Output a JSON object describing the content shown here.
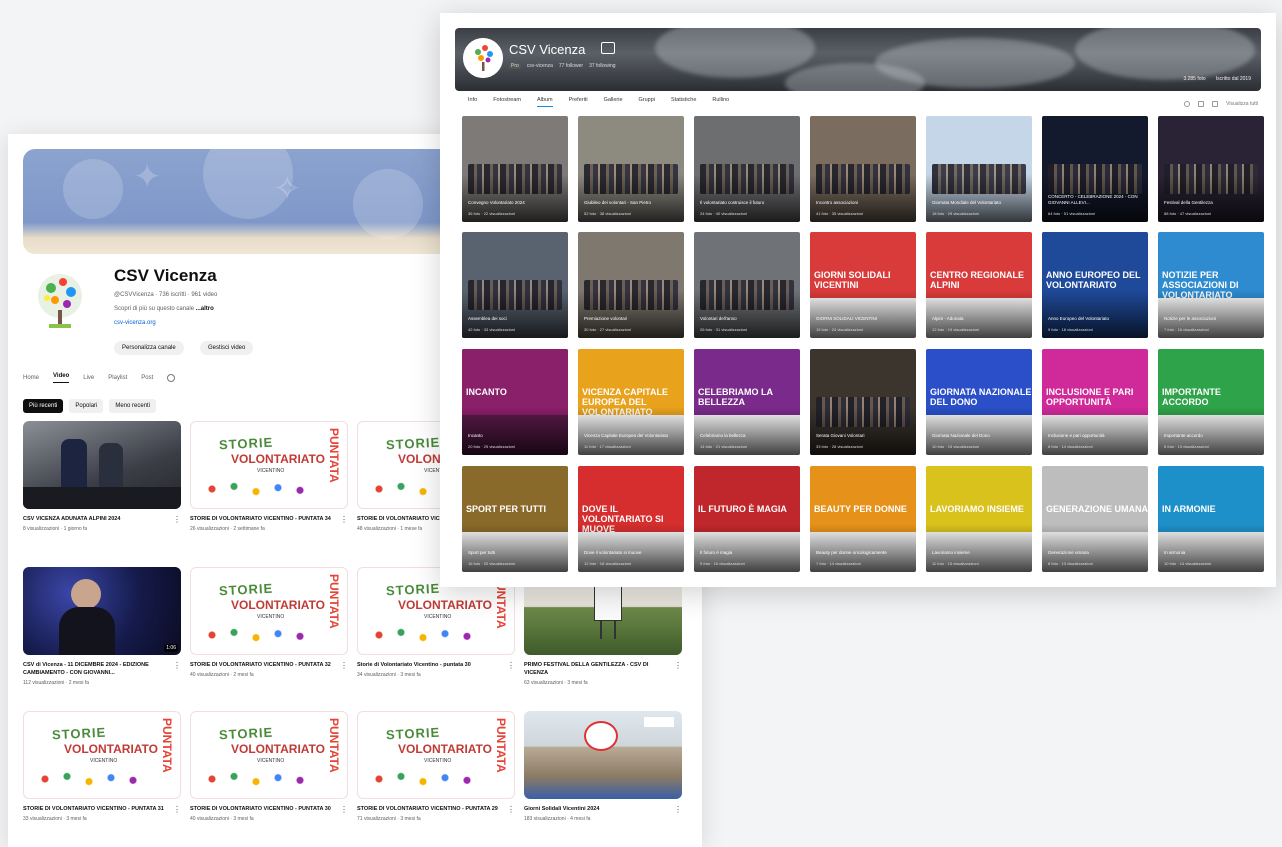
{
  "youtube": {
    "channel_name": "CSV Vicenza",
    "channel_meta": "@CSVVicenza · 736 iscritti · 961 video",
    "description": "Scopri di più su questo canale",
    "description_more": "...altro",
    "link": "csv-vicenza.org",
    "customize_label": "Personalizza canale",
    "manage_label": "Gestisci video",
    "tabs": [
      "Home",
      "Video",
      "Live",
      "Playlist",
      "Post"
    ],
    "active_tab": "Video",
    "filters": [
      "Più recenti",
      "Popolari",
      "Meno recenti"
    ],
    "videos": [
      {
        "title": "CSV VICENZA ADUNATA ALPINI 2024",
        "meta": "8 visualizzazioni · 1 giorno fa"
      },
      {
        "title": "STORIE DI VOLONTARIATO VICENTINO - PUNTATA 34",
        "meta": "26 visualizzazioni · 2 settimane fa"
      },
      {
        "title": "STORIE DI VOLONTARIATO VICENTINO - PUNTATA 33",
        "meta": "48 visualizzazioni · 1 mese fa"
      },
      {
        "title": "CSV di Vicenza - 11 DICEMBRE 2024 - EDIZIONE CAMBIAMENTO - CON GIOVANNI...",
        "meta": "112 visualizzazioni · 2 mesi fa",
        "duration": "1:06"
      },
      {
        "title": "STORIE DI VOLONTARIATO VICENTINO - PUNTATA 32",
        "meta": "40 visualizzazioni · 2 mesi fa"
      },
      {
        "title": "Storie di Volontariato Vicentino - puntata 30",
        "meta": "34 visualizzazioni · 3 mesi fa"
      },
      {
        "title": "PRIMO FESTIVAL DELLA GENTILEZZA - CSV DI VICENZA",
        "meta": "63 visualizzazioni · 3 mesi fa"
      },
      {
        "title": "STORIE DI VOLONTARIATO VICENTINO - PUNTATA 31",
        "meta": "33 visualizzazioni · 3 mesi fa"
      },
      {
        "title": "STORIE DI VOLONTARIATO VICENTINO - PUNTATA 30",
        "meta": "40 visualizzazioni · 3 mesi fa"
      },
      {
        "title": "STORIE DI VOLONTARIATO VICENTINO - PUNTATA 29",
        "meta": "71 visualizzazioni · 3 mesi fa"
      },
      {
        "title": "Giorni Solidali Vicentini 2024",
        "meta": "183 visualizzazioni · 4 mesi fa"
      }
    ],
    "storie_word1": "STORIE",
    "storie_word2": "VOLONTARIATO",
    "storie_word3": "VICENTINO",
    "puntata_label": "PUNTATA"
  },
  "flickr": {
    "name": "CSV Vicenza",
    "sub": [
      "Pro",
      "csv-vicenza",
      "77 follower",
      "37 following"
    ],
    "stats": [
      "3.285 foto",
      "Iscritto dal 2019"
    ],
    "tabs": [
      "Info",
      "Fotostream",
      "Album",
      "Preferiti",
      "Gallerie",
      "Gruppi",
      "Statistiche",
      "Rullino"
    ],
    "active_tab": "Album",
    "share_label": "Visualizza tutti",
    "albums": [
      {
        "title": "Convegno Volontariato 2024",
        "meta": "36 foto · 22 visualizzazioni",
        "bg": "#7e7a78"
      },
      {
        "title": "Giubileo dei volontari - San Pietro",
        "meta": "52 foto · 38 visualizzazioni",
        "bg": "#8d8a80"
      },
      {
        "title": "Il volontariato costruisce il futuro",
        "meta": "24 foto · 40 visualizzazioni",
        "bg": "#6d6e70"
      },
      {
        "title": "Incontro associazioni",
        "meta": "41 foto · 35 visualizzazioni",
        "bg": "#7a6c5e"
      },
      {
        "title": "Giornata Mondiale del Volontariato",
        "meta": "18 foto · 29 visualizzazioni",
        "bg": "#c5d6e8"
      },
      {
        "title": "CONCERTO - CELEBRAZIONE 2024 - CON GIOVANNI ALLEVI...",
        "meta": "64 foto · 51 visualizzazioni",
        "bg": "#141a2e"
      },
      {
        "title": "Festival della Gentilezza",
        "meta": "88 foto · 47 visualizzazioni",
        "bg": "#2a2335"
      },
      {
        "title": "Assemblea dei soci",
        "meta": "42 foto · 33 visualizzazioni",
        "bg": "#596370"
      },
      {
        "title": "Premiazione volontari",
        "meta": "30 foto · 27 visualizzazioni",
        "bg": "#7f786e"
      },
      {
        "title": "Volontari dell'anno",
        "meta": "26 foto · 31 visualizzazioni",
        "bg": "#6f7377"
      },
      {
        "title": "GIORNI SOLIDALI VICENTINI",
        "meta": "15 foto · 24 visualizzazioni",
        "bg": "#ffffff",
        "banner": "#d93b3b",
        "text": "GIORNI SOLIDALI VICENTINI"
      },
      {
        "title": "Alpini - Adunata",
        "meta": "12 foto · 19 visualizzazioni",
        "bg": "#ffffff",
        "banner": "#d93b3b",
        "text": "CENTRO REGIONALE ALPINI"
      },
      {
        "title": "Anno Europeo del Volontariato",
        "meta": "9 foto · 18 visualizzazioni",
        "bg": "#1f4a9a",
        "banner": "#1f4a9a",
        "text": "ANNO EUROPEO DEL VOLONTARIATO"
      },
      {
        "title": "Notizie per le associazioni",
        "meta": "7 foto · 16 visualizzazioni",
        "bg": "#ffffff",
        "banner": "#2e8bd0",
        "text": "NOTIZIE PER ASSOCIAZIONI DI VOLONTARIATO"
      },
      {
        "title": "Incanto",
        "meta": "20 foto · 25 visualizzazioni",
        "bg": "#5a1a4a",
        "banner": "#8a1f6a",
        "text": "INCANTO"
      },
      {
        "title": "Vicenza Capitale Europea del Volontariato",
        "meta": "11 foto · 17 visualizzazioni",
        "bg": "#ffffff",
        "banner": "#e8a21c",
        "text": "VICENZA CAPITALE EUROPEA DEL VOLONTARIATO"
      },
      {
        "title": "Celebriamo la bellezza",
        "meta": "14 foto · 21 visualizzazioni",
        "bg": "#ffffff",
        "banner": "#7a2a8a",
        "text": "CELEBRIAMO LA BELLEZZA"
      },
      {
        "title": "Serata Giovani Volontari",
        "meta": "33 foto · 28 visualizzazioni",
        "bg": "#3c352e"
      },
      {
        "title": "Giornata Nazionale del Dono",
        "meta": "10 foto · 15 visualizzazioni",
        "bg": "#ffffff",
        "banner": "#2a4fc8",
        "text": "GIORNATA NAZIONALE DEL DONO"
      },
      {
        "title": "Inclusione e pari opportunità",
        "meta": "8 foto · 14 visualizzazioni",
        "bg": "#ffffff",
        "banner": "#d0299a",
        "text": "INCLUSIONE E PARI OPPORTUNITÀ"
      },
      {
        "title": "Importante accordo",
        "meta": "6 foto · 13 visualizzazioni",
        "bg": "#ffffff",
        "banner": "#2ea34a",
        "text": "IMPORTANTE ACCORDO"
      },
      {
        "title": "Sport per tutti",
        "meta": "16 foto · 20 visualizzazioni",
        "bg": "#ffffff",
        "banner": "#8a6a2a",
        "text": "SPORT PER TUTTI"
      },
      {
        "title": "Dove il volontariato si muove",
        "meta": "12 foto · 18 visualizzazioni",
        "bg": "#ffffff",
        "banner": "#d62e2e",
        "text": "DOVE IL VOLONTARIATO SI MUOVE"
      },
      {
        "title": "Il futuro è magia",
        "meta": "9 foto · 16 visualizzazioni",
        "bg": "#ffffff",
        "banner": "#c0272d",
        "text": "IL FUTURO È MAGIA"
      },
      {
        "title": "Beauty per donne oncologicamente",
        "meta": "7 foto · 14 visualizzazioni",
        "bg": "#ffffff",
        "banner": "#e6921a",
        "text": "BEAUTY PER DONNE"
      },
      {
        "title": "Lavoriamo insieme",
        "meta": "11 foto · 15 visualizzazioni",
        "bg": "#ffffff",
        "banner": "#d9c21c",
        "text": "LAVORIAMO INSIEME"
      },
      {
        "title": "Generazione umana",
        "meta": "8 foto · 13 visualizzazioni",
        "bg": "#ffffff",
        "banner": "#bdbdbd",
        "text": "GENERAZIONE UMANA"
      },
      {
        "title": "In armonia",
        "meta": "10 foto · 14 visualizzazioni",
        "bg": "#ffffff",
        "banner": "#1e90c9",
        "text": "IN ARMONIE"
      }
    ]
  }
}
